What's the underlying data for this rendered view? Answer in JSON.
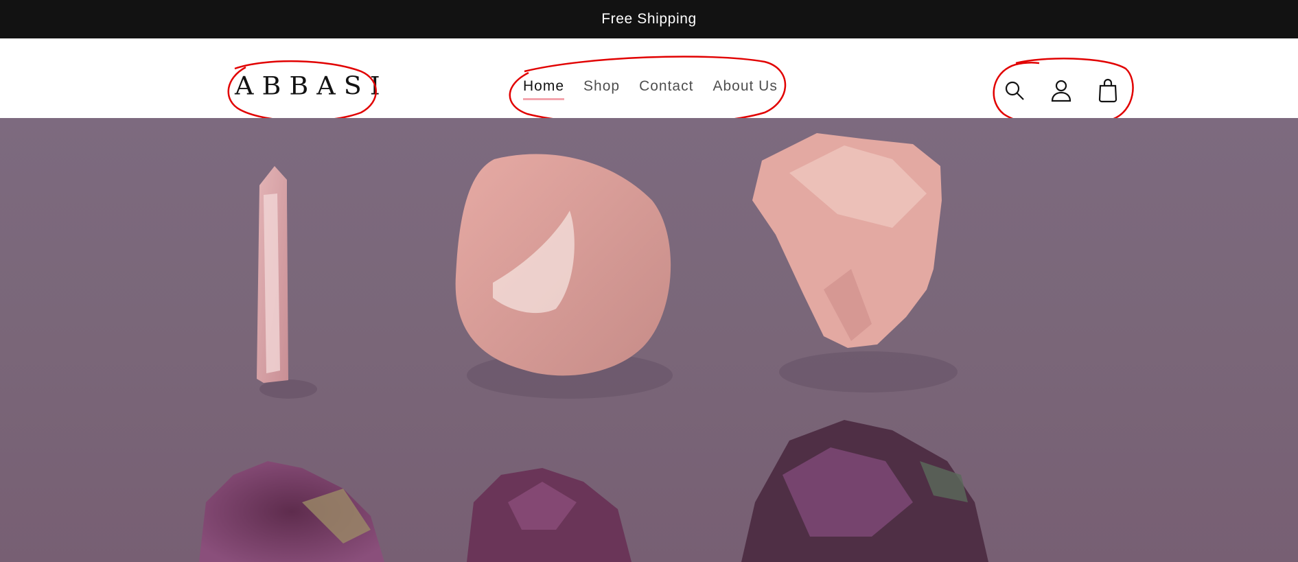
{
  "announcement": {
    "text": "Free Shipping"
  },
  "header": {
    "logo": "ABBASI",
    "nav": [
      {
        "label": "Home",
        "active": true
      },
      {
        "label": "Shop",
        "active": false
      },
      {
        "label": "Contact",
        "active": false
      },
      {
        "label": "About Us",
        "active": false
      }
    ],
    "icons": [
      "search-icon",
      "account-icon",
      "cart-icon"
    ]
  },
  "hero": {
    "image": "rose quartz and amethyst crystals on purple background"
  },
  "colors": {
    "announcement_bg": "#121212",
    "active_underline": "#f3a4ad",
    "annotation": "#e10000",
    "hero_bg": "#7a6779"
  }
}
